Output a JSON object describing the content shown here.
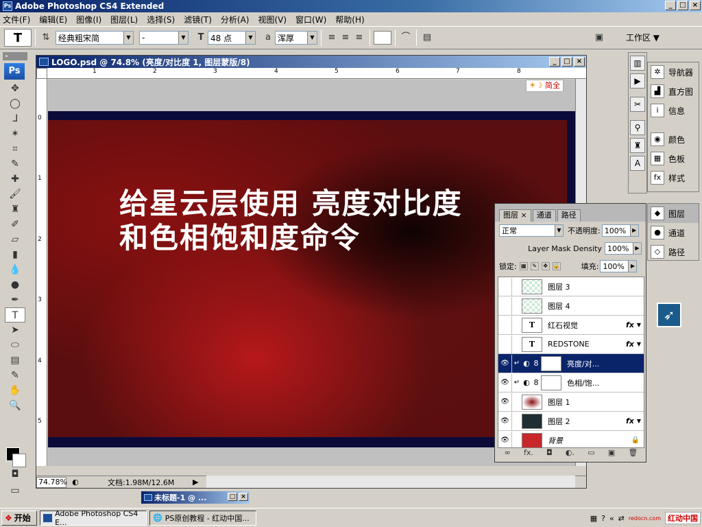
{
  "window": {
    "app_title": "Adobe Photoshop CS4 Extended",
    "ps_badge": "Ps",
    "min": "_",
    "max": "□",
    "close": "×"
  },
  "menu": [
    "文件(F)",
    "编辑(E)",
    "图像(I)",
    "图层(L)",
    "选择(S)",
    "滤镜(T)",
    "分析(A)",
    "视图(V)",
    "窗口(W)",
    "帮助(H)"
  ],
  "options": {
    "tool_glyph": "T",
    "font_family": "经典粗宋简",
    "font_style": "-",
    "font_size": "48 点",
    "aa_label": "a",
    "aa_mode": "浑厚",
    "workspace": "工作区 ▼"
  },
  "document": {
    "title": "LOGO.psd @ 74.8% (亮度/对比度 1, 图层蒙版/8)",
    "zoom": "74.78%",
    "doc_info": "文档:1.98M/12.6M",
    "canvas_line1": "给星云层使用 亮度对比度",
    "canvas_line2": "和色相饱和度命令",
    "im_badge": "简全",
    "ruler_h": [
      "1",
      "2",
      "3",
      "4",
      "5",
      "6",
      "7",
      "8"
    ],
    "ruler_v": [
      "0",
      "1",
      "2",
      "3",
      "4",
      "5"
    ]
  },
  "minimized_doc": "未标题-1 @ ...",
  "dock": {
    "group1": [
      {
        "icon": "navigator-icon",
        "label": "导航器",
        "glyph": "✲"
      },
      {
        "icon": "histogram-icon",
        "label": "直方图",
        "glyph": "▟"
      },
      {
        "icon": "info-icon",
        "label": "信息",
        "glyph": "i"
      },
      {
        "icon": "color-icon",
        "label": "颜色",
        "glyph": "◉"
      },
      {
        "icon": "swatches-icon",
        "label": "色板",
        "glyph": "▦"
      },
      {
        "icon": "styles-icon",
        "label": "样式",
        "glyph": "fx"
      }
    ],
    "group2": [
      {
        "icon": "layers-icon",
        "label": "图层",
        "glyph": "◆"
      },
      {
        "icon": "channels-icon",
        "label": "通道",
        "glyph": "●"
      },
      {
        "icon": "paths-icon",
        "label": "路径",
        "glyph": "◇"
      }
    ]
  },
  "layers_panel": {
    "tabs": [
      "图层 ×",
      "通道",
      "路径"
    ],
    "blend_mode": "正常",
    "opacity_label": "不透明度:",
    "opacity": "100%",
    "mask_density_label": "Layer Mask Density",
    "mask_density": "100%",
    "lock_label": "锁定:",
    "fill_label": "填充:",
    "fill": "100%",
    "layers": [
      {
        "name": "图层 3",
        "thumb": "trans",
        "visible": false,
        "fx": false
      },
      {
        "name": "图层 4",
        "thumb": "trans",
        "visible": false,
        "fx": false
      },
      {
        "name": "红石视觉",
        "thumb": "t",
        "visible": false,
        "fx": true
      },
      {
        "name": "REDSTONE",
        "thumb": "t",
        "visible": false,
        "fx": true
      },
      {
        "name": "亮度/对...",
        "thumb": "white",
        "visible": true,
        "fx": false,
        "selected": true,
        "adjust": true
      },
      {
        "name": "色相/饱...",
        "thumb": "white",
        "visible": true,
        "fx": false,
        "adjust": true
      },
      {
        "name": "图层 1",
        "thumb": "nebula",
        "visible": true,
        "fx": false
      },
      {
        "name": "图层 2",
        "thumb": "dark",
        "visible": true,
        "fx": true
      },
      {
        "name": "背景",
        "thumb": "red",
        "visible": true,
        "fx": false,
        "locked": true
      }
    ],
    "bottom": [
      "∞",
      "fx.",
      "◘",
      "◐.",
      "▭",
      "▣",
      "🗑"
    ]
  },
  "taskbar": {
    "start": "开始",
    "items": [
      "Adobe Photoshop CS4 E...",
      "PS原创教程 - 红动中国..."
    ],
    "tray_logo": "红动中国",
    "tray_url": "redocn.com"
  }
}
